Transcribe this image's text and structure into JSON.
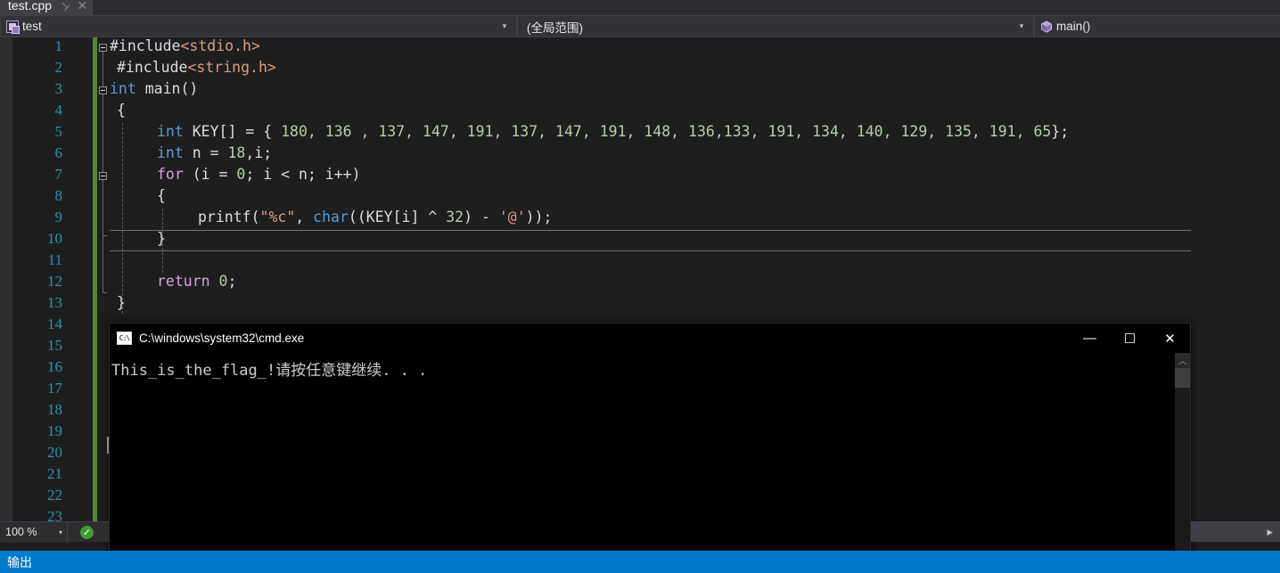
{
  "window": {
    "tab": {
      "title": "test.cpp",
      "pin_icon": "pin-icon",
      "close_icon": "close-icon"
    }
  },
  "navbar": {
    "project": {
      "label": "test",
      "icon": "project-icon",
      "arrow": "▾"
    },
    "scope": {
      "label": "(全局范围)",
      "arrow": "▾"
    },
    "member": {
      "label": "main()",
      "icon": "method-cube-icon",
      "arrow": "▾"
    }
  },
  "editor": {
    "line_numbers": [
      "1",
      "2",
      "3",
      "4",
      "5",
      "6",
      "7",
      "8",
      "9",
      "10",
      "11",
      "12",
      "13",
      "14",
      "15",
      "16",
      "17",
      "18",
      "19",
      "20",
      "21",
      "22",
      "23"
    ],
    "current_line": 10,
    "caret_line": 18,
    "code": {
      "l1_pp": "#include",
      "l1_path": "<stdio.h>",
      "l2_pp": "#include",
      "l2_path": "<string.h>",
      "l3_type": "int",
      "l3_rest": " main()",
      "l4": "{",
      "l5_type": "int",
      "l5_name": " KEY[] = { ",
      "l5_values": "180, 136 , 137, 147, 191, 137, 147, 191, 148, 136,133, 191, 134, 140, 129, 135, 191, 65",
      "l5_end": "};",
      "l6_type": "int",
      "l6_a": " n = ",
      "l6_num": "18",
      "l6_b": ",i;",
      "l7_kw": "for",
      "l7_a": " (i = ",
      "l7_zero": "0",
      "l7_b": "; i < n; i++)",
      "l8": "{",
      "l9_fn": "printf(",
      "l9_str": "\"%c\"",
      "l9_comma": ", ",
      "l9_type": "char",
      "l9_a": "((KEY[i] ^ ",
      "l9_num": "32",
      "l9_b": ") - ",
      "l9_char": "'@'",
      "l9_c": "));",
      "l10": "}",
      "l12_kw": "return",
      "l12_sp": " ",
      "l12_zero": "0",
      "l12_semi": ";",
      "l13": "}"
    }
  },
  "cmd_window": {
    "title": "C:\\windows\\system32\\cmd.exe",
    "icon": "console-icon",
    "minimize_label": "—",
    "maximize_label": "☐",
    "close_label": "✕",
    "output_line": "This_is_the_flag_!请按任意键继续. . .",
    "scroll_up_arrow": "︿"
  },
  "status_bar": {
    "zoom_value": "100 %",
    "zoom_arrow": "▾",
    "health_badge": "✓",
    "right_arrow": "▸"
  },
  "bottom": {
    "output_tab_label": "输出"
  },
  "colors": {
    "accent": "#007acc",
    "tab_active_bg": "#3f3f46",
    "editor_bg": "#1e1e1e",
    "chrome_bg": "#2d2d30",
    "linenum": "#2b91af",
    "savebar_green": "#57813e",
    "keyword": "#d8a0df",
    "type": "#569cd6",
    "string": "#d69d85",
    "number": "#b5cea8",
    "plain": "#dcdcdc"
  }
}
